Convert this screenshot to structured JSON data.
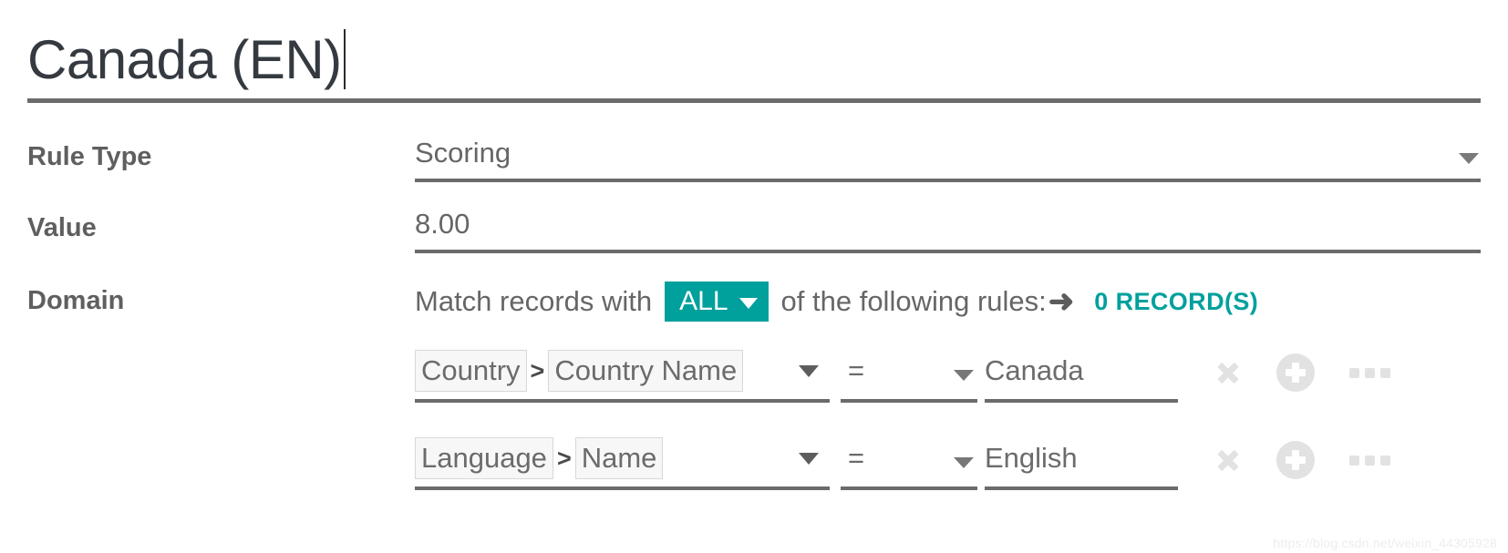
{
  "record": {
    "title": "Canada (EN)"
  },
  "fields": {
    "rule_type": {
      "label": "Rule Type",
      "value": "Scoring",
      "caret_icon": "chevron-down-icon"
    },
    "value": {
      "label": "Value",
      "value": "8.00"
    },
    "domain": {
      "label": "Domain",
      "prefix_text": "Match records with",
      "match_mode": "ALL",
      "suffix_text": "of the following rules:",
      "arrow_icon": "arrow-right-icon",
      "record_count": "0 RECORD(S)"
    }
  },
  "domain_rules": [
    {
      "model": "Country",
      "separator": ">",
      "field": "Country Name",
      "operator": "=",
      "value": "Canada",
      "actions": {
        "delete": "close-icon",
        "add": "plus-circle-icon",
        "more": "ellipsis-icon"
      }
    },
    {
      "model": "Language",
      "separator": ">",
      "field": "Name",
      "operator": "=",
      "value": "English",
      "actions": {
        "delete": "close-icon",
        "add": "plus-circle-icon",
        "more": "ellipsis-icon"
      }
    }
  ],
  "colors": {
    "accent": "#00a09d",
    "text": "#666666",
    "title": "#343a40",
    "underline": "#6b6b6b",
    "icon_muted": "#e2e2e2"
  },
  "watermark": "https://blog.csdn.net/weixin_44305928"
}
